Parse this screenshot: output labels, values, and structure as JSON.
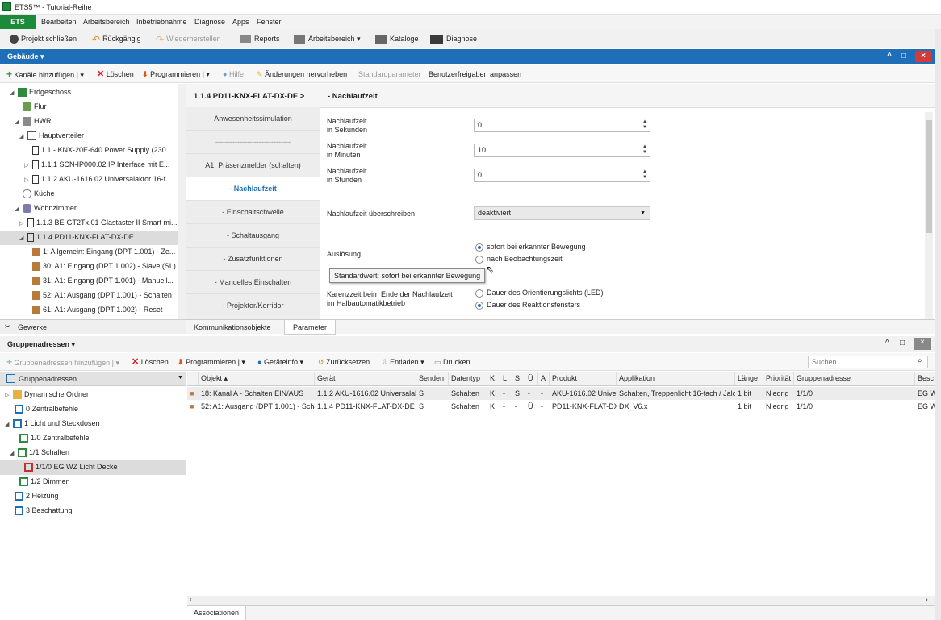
{
  "window": {
    "title": "ETS5™ - Tutorial-Reihe"
  },
  "menu": {
    "brand": "ETS",
    "items": [
      "Bearbeiten",
      "Arbeitsbereich",
      "Inbetriebnahme",
      "Diagnose",
      "Apps",
      "Fenster"
    ]
  },
  "toolbar": {
    "close_project": "Projekt schließen",
    "undo": "Rückgängig",
    "redo": "Wiederherstellen",
    "reports": "Reports",
    "workspace": "Arbeitsbereich",
    "catalogs": "Kataloge",
    "diagnose": "Diagnose"
  },
  "building_panel": {
    "title": "Gebäude",
    "win": {
      "min": "^",
      "max": "□",
      "close": "×"
    },
    "toolbar": {
      "add_channels": "Kanäle hinzufügen",
      "delete": "Löschen",
      "program": "Programmieren",
      "help": "Hilfe",
      "highlight": "Änderungen hervorheben",
      "defaults": "Standardparameter",
      "user_rights": "Benutzerfreigaben anpassen"
    },
    "tree": [
      "Erdgeschoss",
      "Flur",
      "HWR",
      "Hauptverteiler",
      "1.1.- KNX-20E-640 Power Supply (230...",
      "1.1.1 SCN-IP000.02 IP Interface mit E...",
      "1.1.2 AKU-1616.02 Universalaktor 16-f...",
      "Küche",
      "Wohnzimmer",
      "1.1.3 BE-GT2Tx.01 Glastaster II Smart mi...",
      "1.1.4 PD11-KNX-FLAT-DX-DE",
      "1: Allgemein: Eingang (DPT 1.001) - Ze...",
      "30: A1: Eingang (DPT 1.002) - Slave (SL)",
      "31: A1: Eingang (DPT 1.001) - Manuell...",
      "52: A1: Ausgang (DPT 1.001) - Schalten",
      "61: A1: Ausgang (DPT 1.002) - Reset"
    ],
    "footer": "Gewerke"
  },
  "params": {
    "device": "1.1.4 PD11-KNX-FLAT-DX-DE >",
    "section": "- Nachlaufzeit",
    "nav": [
      "Anwesenheitssimulation",
      "-------------------------------",
      "A1: Präsenzmelder (schalten)",
      "- Nachlaufzeit",
      "- Einschaltschwelle",
      "- Schaltausgang",
      "- Zusatzfunktionen",
      "- Manuelles Einschalten",
      "- Projektor/Korridor"
    ],
    "fields": [
      {
        "l1": "Nachlaufzeit",
        "l2": "in Sekunden",
        "value": "0"
      },
      {
        "l1": "Nachlaufzeit",
        "l2": "in Minuten",
        "value": "10"
      },
      {
        "l1": "Nachlaufzeit",
        "l2": "in Stunden",
        "value": "0"
      }
    ],
    "override_label": "Nachlaufzeit überschreiben",
    "override_value": "deaktiviert",
    "trigger_label": "Auslösung",
    "trigger_opt1": "sofort bei erkannter Bewegung",
    "trigger_opt2": "nach Beobachtungszeit",
    "tooltip": "Standardwert: sofort bei erkannter Bewegung",
    "karenz_l1": "Karenzzeit beim Ende der Nachlaufzeit",
    "karenz_l2": "im Halbautomatikbetrieb",
    "karenz_opt1": "Dauer des Orientierungslichts (LED)",
    "karenz_opt2": "Dauer des Reaktionsfensters",
    "tab1": "Kommunikationsobjekte",
    "tab2": "Parameter"
  },
  "ga_panel": {
    "title": "Gruppenadressen",
    "toolbar": {
      "add": "Gruppenadressen hinzufügen",
      "delete": "Löschen",
      "program": "Programmieren",
      "devinfo": "Geräteinfo",
      "reset": "Zurücksetzen",
      "unload": "Entladen",
      "print": "Drucken",
      "search_placeholder": "Suchen"
    },
    "tree_header": "Gruppenadressen",
    "tree": [
      "Dynamische Ordner",
      "0 Zentralbefehle",
      "1 Licht und Steckdosen",
      "1/0 Zentralbefehle",
      "1/1 Schalten",
      "1/1/0 EG WZ Licht Decke",
      "1/2 Dimmen",
      "2 Heizung",
      "3 Beschattung"
    ],
    "columns": [
      "Objekt",
      "Gerät",
      "Senden",
      "Datentyp",
      "K",
      "L",
      "S",
      "Ü",
      "A",
      "Produkt",
      "Applikation",
      "Länge",
      "Priorität",
      "Gruppenadresse",
      "Besc"
    ],
    "rows": [
      [
        "18: Kanal A - Schalten EIN/AUS",
        "1.1.2 AKU-1616.02 Universalakt...",
        "S",
        "Schalten",
        "K",
        "-",
        "S",
        "-",
        "-",
        "AKU-1616.02 Univer...",
        "Schalten, Treppenlicht 16-fach / Jalo...",
        "1 bit",
        "Niedrig",
        "1/1/0",
        "EG W"
      ],
      [
        "52: A1: Ausgang (DPT 1.001) - Schal...",
        "1.1.4 PD11-KNX-FLAT-DX-DE",
        "S",
        "Schalten",
        "K",
        "-",
        "-",
        "Ü",
        "-",
        "PD11-KNX-FLAT-DX...",
        "DX_V6.x",
        "1 bit",
        "Niedrig",
        "1/1/0",
        "EG W"
      ]
    ],
    "footer_tab": "Associationen"
  }
}
